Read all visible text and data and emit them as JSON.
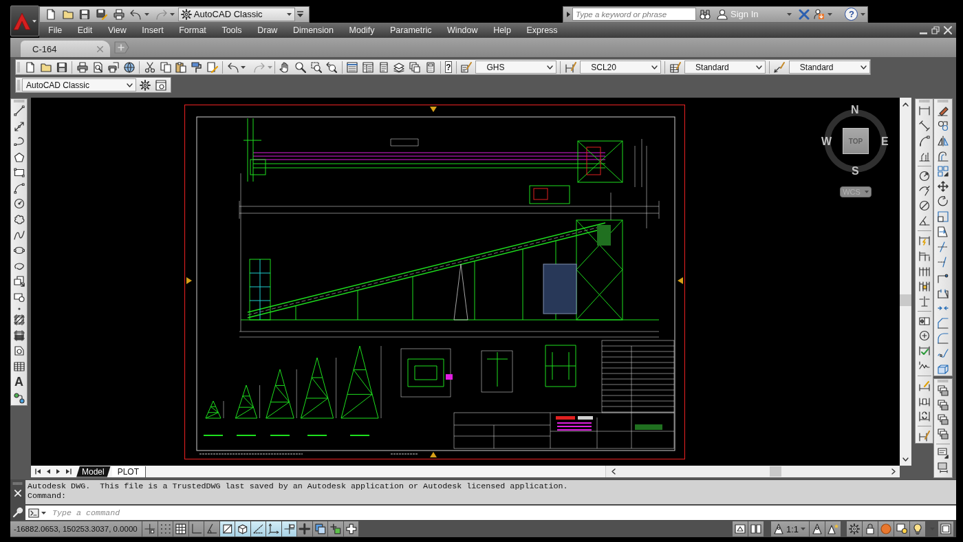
{
  "quick_access": {
    "undo": {
      "disabled": false
    },
    "redo": {
      "disabled": true
    },
    "workspace": "AutoCAD Classic"
  },
  "infocenter": {
    "search": {
      "placeholder": "Type a keyword or phrase"
    },
    "sign_in": "Sign In",
    "help": "?"
  },
  "menu": [
    "File",
    "Edit",
    "View",
    "Insert",
    "Format",
    "Tools",
    "Draw",
    "Dimension",
    "Modify",
    "Parametric",
    "Window",
    "Help",
    "Express"
  ],
  "file_tabs": [
    {
      "label": "C-164",
      "selected": true
    }
  ],
  "standard_toolbar": {
    "undo": {
      "disabled": false
    },
    "redo": {
      "disabled": true
    },
    "help": "?"
  },
  "styles_toolbar": [
    {
      "kind": "text_style",
      "value": "GHS"
    },
    {
      "kind": "dimension_style",
      "value": "SCL20"
    },
    {
      "kind": "table_style",
      "value": "Standard"
    },
    {
      "kind": "multileader_style",
      "value": "Standard"
    }
  ],
  "workspaces_toolbar": {
    "value": "AutoCAD Classic"
  },
  "draw_toolbar": {
    "text_tool": "A"
  },
  "viewcube": {
    "north": "N",
    "west": "W",
    "face": "TOP",
    "east": "E",
    "south": "S",
    "ucs": "WCS"
  },
  "layout_tabs": [
    {
      "label": "Model",
      "selected": true
    },
    {
      "label": "PLOT",
      "selected": false
    }
  ],
  "command_history": [
    "Autodesk DWG.  This file is a TrustedDWG last saved by an Autodesk application or Autodesk licensed application.",
    "Command:"
  ],
  "command_line": {
    "placeholder": "Type a command"
  },
  "status_bar": {
    "coordinates": "-16882.0653, 150253.3037, 0.0000",
    "toggles": [
      {
        "on": false
      },
      {
        "on": false
      },
      {
        "on": false
      },
      {
        "on": false
      },
      {
        "on": false
      },
      {
        "on": true
      },
      {
        "on": true
      },
      {
        "on": true
      },
      {
        "on": true
      },
      {
        "on": true
      },
      {
        "on": false
      },
      {
        "on": false
      },
      {
        "on": false
      },
      {
        "on": false
      }
    ],
    "annotation_scale": "1:1"
  }
}
